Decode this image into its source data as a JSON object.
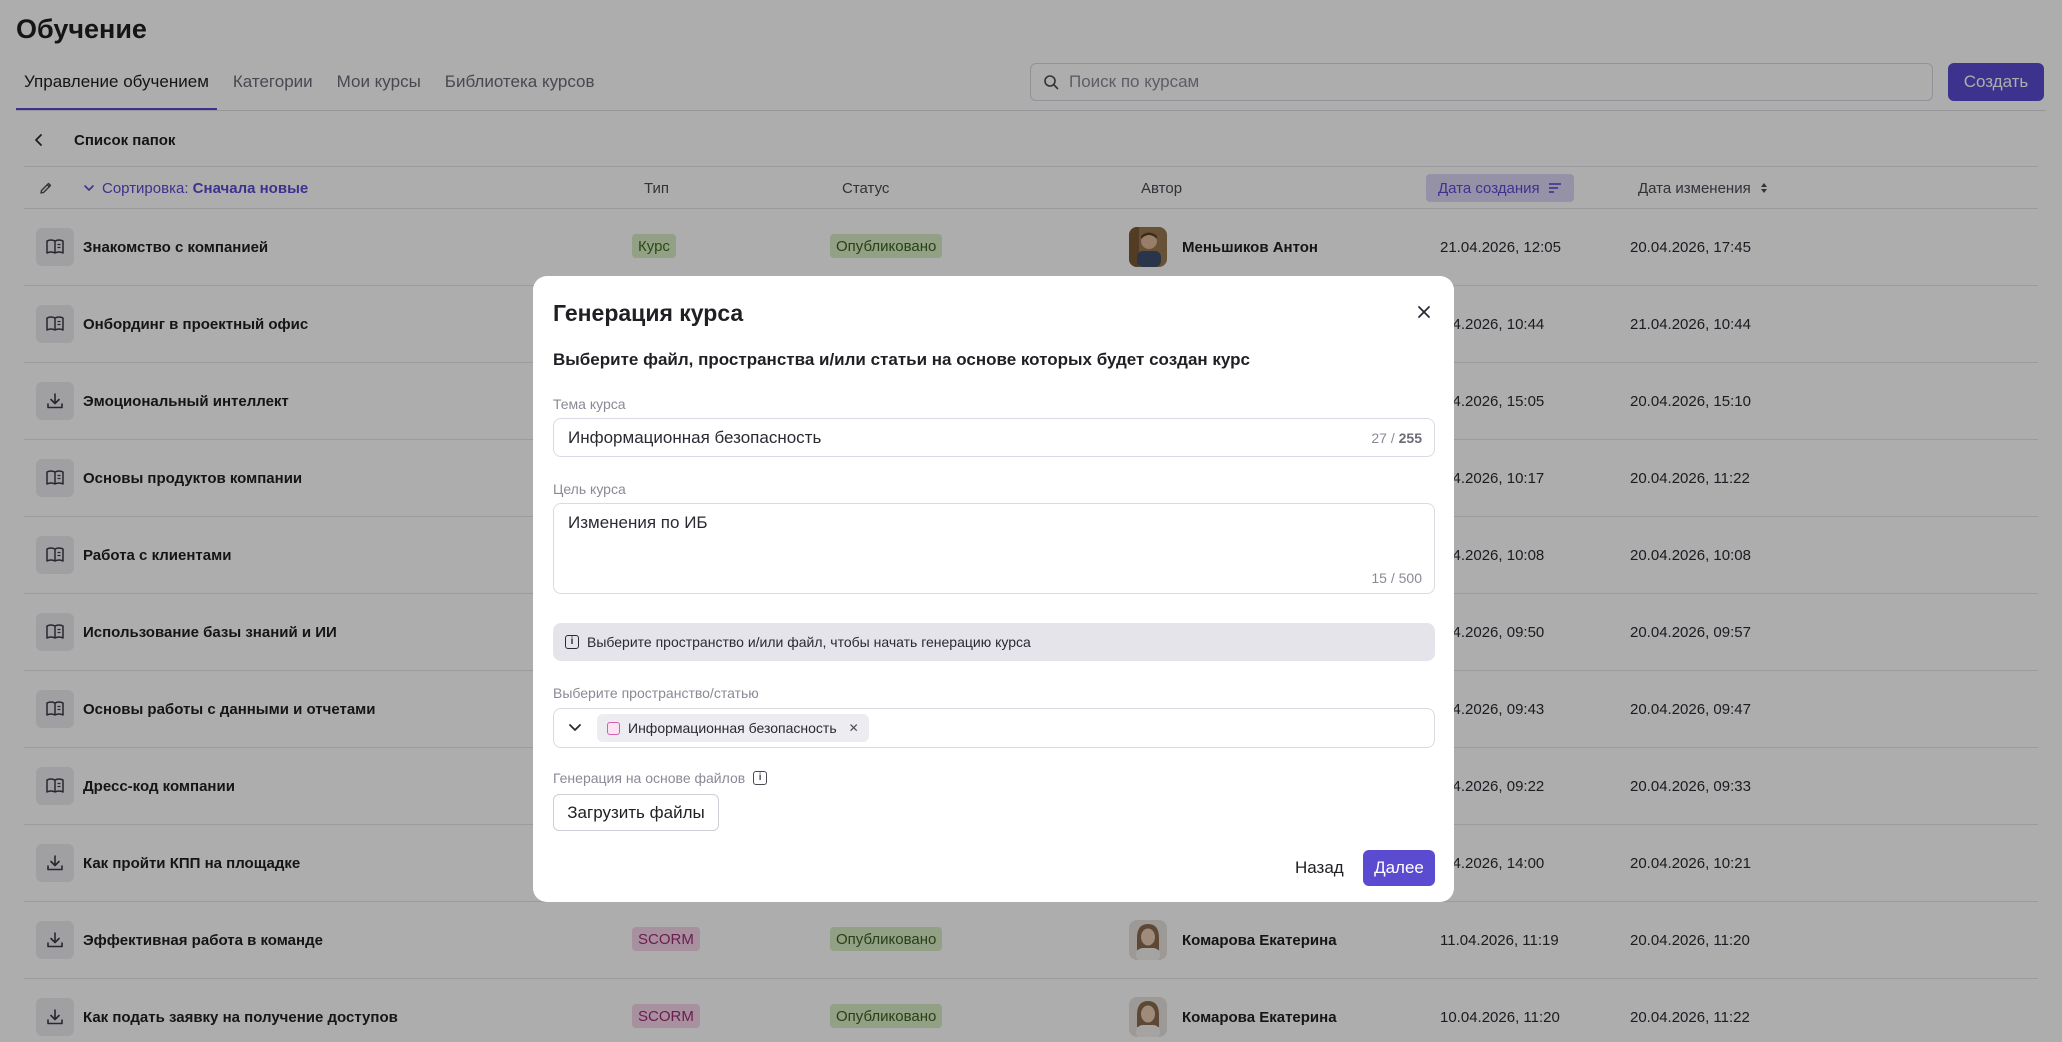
{
  "page": {
    "title": "Обучение",
    "tabs": [
      {
        "label": "Управление обучением"
      },
      {
        "label": "Категории"
      },
      {
        "label": "Мои курсы"
      },
      {
        "label": "Библиотека курсов"
      }
    ],
    "search_placeholder": "Поиск по курсам",
    "create_label": "Создать",
    "folder_list_label": "Список папок"
  },
  "table": {
    "sort_prefix": "Сортировка:",
    "sort_value": "Сначала новые",
    "col_type": "Тип",
    "col_status": "Статус",
    "col_author": "Автор",
    "col_created": "Дата создания",
    "col_modified": "Дата изменения",
    "rows": [
      {
        "name": "Знакомство с компанией",
        "icon": "book-icon",
        "type": "Курс",
        "status": "Опубликовано",
        "author": "Меньшиков Антон",
        "created": "21.04.2026, 12:05",
        "modified": "20.04.2026, 17:45"
      },
      {
        "name": "Онбординг в проектный офис",
        "icon": "book-icon",
        "type": "",
        "status": "",
        "author": "",
        "created": ".04.2026, 10:44",
        "modified": "21.04.2026, 10:44"
      },
      {
        "name": "Эмоциональный интеллект",
        "icon": "download-icon",
        "type": "",
        "status": "",
        "author": "",
        "created": ".04.2026, 15:05",
        "modified": "20.04.2026, 15:10"
      },
      {
        "name": "Основы продуктов компании",
        "icon": "book-icon",
        "type": "",
        "status": "",
        "author": "",
        "created": ".04.2026, 10:17",
        "modified": "20.04.2026, 11:22"
      },
      {
        "name": "Работа с клиентами",
        "icon": "book-icon",
        "type": "",
        "status": "",
        "author": "",
        "created": ".04.2026, 10:08",
        "modified": "20.04.2026, 10:08"
      },
      {
        "name": "Использование базы знаний и ИИ",
        "icon": "book-icon",
        "type": "",
        "status": "",
        "author": "",
        "created": ".04.2026, 09:50",
        "modified": "20.04.2026, 09:57"
      },
      {
        "name": "Основы работы с данными и отчетами",
        "icon": "book-icon",
        "type": "",
        "status": "",
        "author": "",
        "created": ".04.2026, 09:43",
        "modified": "20.04.2026, 09:47"
      },
      {
        "name": "Дресс-код компании",
        "icon": "book-icon",
        "type": "",
        "status": "",
        "author": "",
        "created": ".04.2026, 09:22",
        "modified": "20.04.2026, 09:33"
      },
      {
        "name": "Как пройти КПП на площадке",
        "icon": "download-icon",
        "type": "",
        "status": "",
        "author": "",
        "created": ".04.2026, 14:00",
        "modified": "20.04.2026, 10:21"
      },
      {
        "name": "Эффективная работа в команде",
        "icon": "download-icon",
        "type": "SCORM",
        "status": "Опубликовано",
        "author": "Комарова Екатерина",
        "created": "11.04.2026, 11:19",
        "modified": "20.04.2026, 11:20"
      },
      {
        "name": "Как подать заявку на получение доступов",
        "icon": "download-icon",
        "type": "SCORM",
        "status": "Опубликовано",
        "author": "Комарова Екатерина",
        "created": "10.04.2026, 11:20",
        "modified": "20.04.2026, 11:22"
      }
    ]
  },
  "modal": {
    "title": "Генерация курса",
    "description": "Выберите файл, пространства и/или статьи на основе которых будет создан курс",
    "topic_label": "Тема курса",
    "topic_value": "Информационная безопасность",
    "topic_counter_current": "27",
    "topic_counter_sep": " / ",
    "topic_counter_max": "255",
    "goal_label": "Цель курса",
    "goal_value": "Изменения по ИБ",
    "goal_counter": "15 / 500",
    "hint": "Выберите пространство и/или файл, чтобы начать генерацию курса",
    "space_label": "Выберите пространство/статью",
    "space_chip": "Информационная безопасность",
    "files_label": "Генерация на основе файлов",
    "upload_label": "Загрузить файлы",
    "back_label": "Назад",
    "next_label": "Далее"
  },
  "colors": {
    "accent": "#5b4bd1",
    "course_badge_bg": "#d8ecc5",
    "scorm_badge_bg": "#f6d6ea",
    "overlay": "rgba(0,0,0,0.32)"
  }
}
